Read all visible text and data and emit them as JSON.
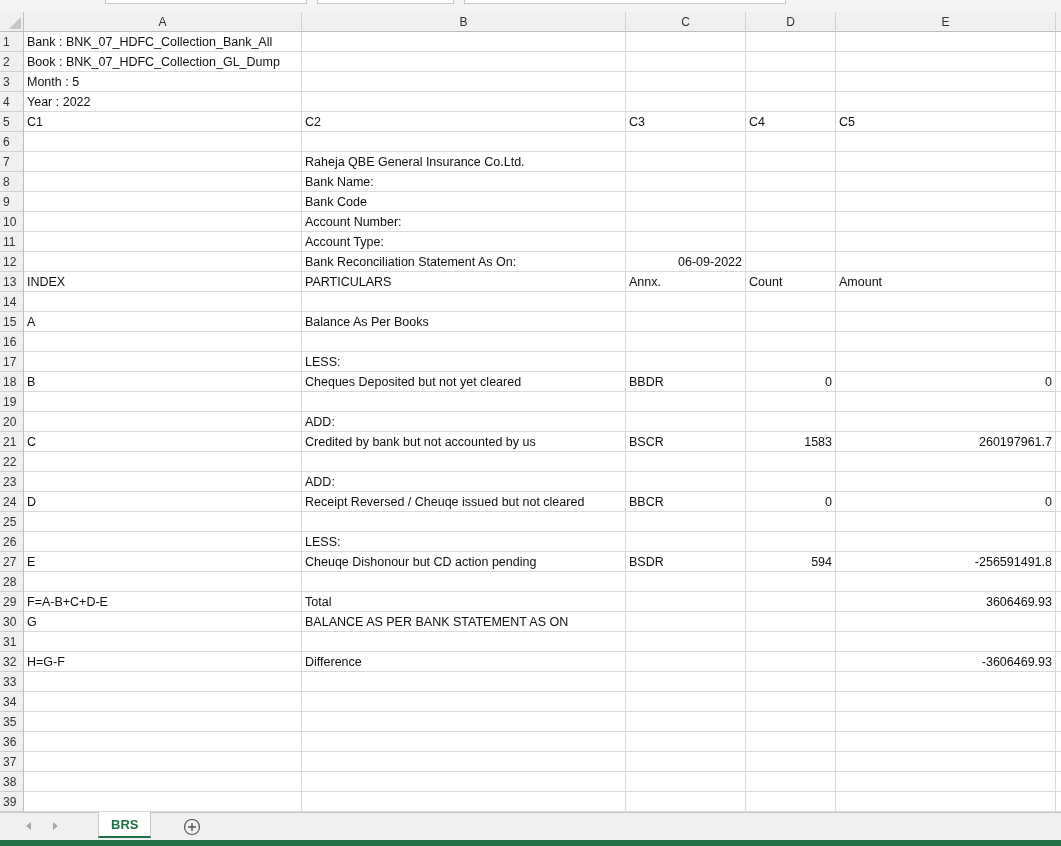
{
  "columns": [
    "A",
    "B",
    "C",
    "D",
    "E"
  ],
  "rows": [
    {
      "number": "1",
      "cells": {
        "A": {
          "text": "Bank : BNK_07_HDFC_Collection_Bank_All"
        }
      }
    },
    {
      "number": "2",
      "cells": {
        "A": {
          "text": "Book : BNK_07_HDFC_Collection_GL_Dump"
        }
      }
    },
    {
      "number": "3",
      "cells": {
        "A": {
          "text": "Month : 5"
        }
      }
    },
    {
      "number": "4",
      "cells": {
        "A": {
          "text": "Year : 2022"
        }
      }
    },
    {
      "number": "5",
      "cells": {
        "A": {
          "text": "C1"
        },
        "B": {
          "text": "C2"
        },
        "C": {
          "text": "C3"
        },
        "D": {
          "text": "C4"
        },
        "E": {
          "text": "C5"
        }
      }
    },
    {
      "number": "6",
      "cells": {}
    },
    {
      "number": "7",
      "cells": {
        "B": {
          "text": "Raheja QBE General Insurance Co.Ltd."
        }
      }
    },
    {
      "number": "8",
      "cells": {
        "B": {
          "text": "Bank Name:"
        }
      }
    },
    {
      "number": "9",
      "cells": {
        "B": {
          "text": "Bank Code"
        }
      }
    },
    {
      "number": "10",
      "cells": {
        "B": {
          "text": "Account Number:"
        }
      }
    },
    {
      "number": "11",
      "cells": {
        "B": {
          "text": "Account Type:"
        }
      }
    },
    {
      "number": "12",
      "cells": {
        "B": {
          "text": "Bank Reconciliation Statement As On:"
        },
        "C": {
          "text": "06-09-2022",
          "kind": "date"
        }
      }
    },
    {
      "number": "13",
      "cells": {
        "A": {
          "text": "INDEX"
        },
        "B": {
          "text": "PARTICULARS"
        },
        "C": {
          "text": "Annx."
        },
        "D": {
          "text": "Count"
        },
        "E": {
          "text": "Amount"
        }
      }
    },
    {
      "number": "14",
      "cells": {}
    },
    {
      "number": "15",
      "cells": {
        "A": {
          "text": "A"
        },
        "B": {
          "text": "Balance As Per Books"
        }
      }
    },
    {
      "number": "16",
      "cells": {}
    },
    {
      "number": "17",
      "cells": {
        "B": {
          "text": "LESS:"
        }
      }
    },
    {
      "number": "18",
      "cells": {
        "A": {
          "text": "B"
        },
        "B": {
          "text": "Cheques Deposited but not yet cleared"
        },
        "C": {
          "text": "BBDR"
        },
        "D": {
          "text": "0",
          "kind": "number"
        },
        "E": {
          "text": "0",
          "kind": "number"
        }
      }
    },
    {
      "number": "19",
      "cells": {}
    },
    {
      "number": "20",
      "cells": {
        "B": {
          "text": "ADD:"
        }
      }
    },
    {
      "number": "21",
      "cells": {
        "A": {
          "text": "C"
        },
        "B": {
          "text": "Credited by bank but not accounted by us"
        },
        "C": {
          "text": "BSCR"
        },
        "D": {
          "text": "1583",
          "kind": "number"
        },
        "E": {
          "text": "260197961.7",
          "kind": "number"
        }
      }
    },
    {
      "number": "22",
      "cells": {}
    },
    {
      "number": "23",
      "cells": {
        "B": {
          "text": "ADD:"
        }
      }
    },
    {
      "number": "24",
      "cells": {
        "A": {
          "text": "D"
        },
        "B": {
          "text": "Receipt Reversed / Cheuqe issued but not cleared"
        },
        "C": {
          "text": "BBCR"
        },
        "D": {
          "text": "0",
          "kind": "number"
        },
        "E": {
          "text": "0",
          "kind": "number"
        }
      }
    },
    {
      "number": "25",
      "cells": {}
    },
    {
      "number": "26",
      "cells": {
        "B": {
          "text": "LESS:"
        }
      }
    },
    {
      "number": "27",
      "cells": {
        "A": {
          "text": "E"
        },
        "B": {
          "text": "Cheuqe Dishonour but CD action pending"
        },
        "C": {
          "text": "BSDR"
        },
        "D": {
          "text": "594",
          "kind": "number"
        },
        "E": {
          "text": "-256591491.8",
          "kind": "number"
        }
      }
    },
    {
      "number": "28",
      "cells": {}
    },
    {
      "number": "29",
      "cells": {
        "A": {
          "text": "F=A-B+C+D-E"
        },
        "B": {
          "text": "Total"
        },
        "E": {
          "text": "3606469.93",
          "kind": "number"
        }
      }
    },
    {
      "number": "30",
      "cells": {
        "A": {
          "text": "G"
        },
        "B": {
          "text": "BALANCE AS PER BANK STATEMENT AS ON"
        }
      }
    },
    {
      "number": "31",
      "cells": {}
    },
    {
      "number": "32",
      "cells": {
        "A": {
          "text": "H=G-F"
        },
        "B": {
          "text": "Difference"
        },
        "E": {
          "text": "-3606469.93",
          "kind": "number"
        }
      }
    },
    {
      "number": "33",
      "cells": {}
    },
    {
      "number": "34",
      "cells": {}
    },
    {
      "number": "35",
      "cells": {}
    },
    {
      "number": "36",
      "cells": {}
    },
    {
      "number": "37",
      "cells": {}
    },
    {
      "number": "38",
      "cells": {}
    },
    {
      "number": "39",
      "cells": {}
    }
  ],
  "sheets": [
    {
      "label": "BRS",
      "selected": true
    }
  ]
}
